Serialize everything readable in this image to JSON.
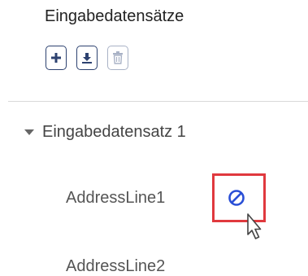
{
  "section": {
    "title": "Eingabedatensätze"
  },
  "toolbar": {
    "buttons": [
      {
        "icon": "plus-icon"
      },
      {
        "icon": "download-icon"
      },
      {
        "icon": "trash-icon",
        "disabled": true
      }
    ]
  },
  "tree": {
    "group_label": "Eingabedatensatz 1",
    "expanded": true,
    "items": [
      {
        "label": "AddressLine1",
        "action_icon": "ban-icon"
      },
      {
        "label": "AddressLine2"
      }
    ]
  },
  "colors": {
    "accent": "#2d4270",
    "highlight": "#e0393e",
    "ban_icon": "#2a4fd6"
  }
}
